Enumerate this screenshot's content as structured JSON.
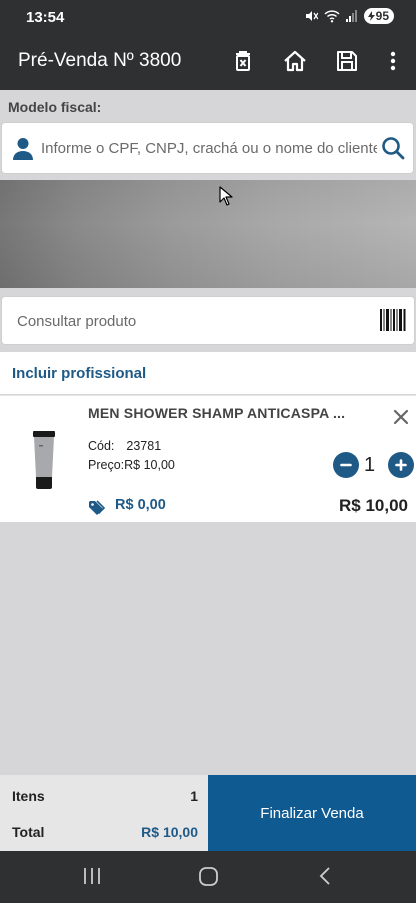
{
  "status": {
    "time": "13:54",
    "battery": "95"
  },
  "appbar": {
    "title": "Pré-Venda Nº 3800"
  },
  "form": {
    "fiscal_label": "Modelo fiscal:",
    "customer_placeholder": "Informe o CPF, CNPJ, crachá ou o nome do cliente",
    "product_placeholder": "Consultar produto",
    "incluir_profissional": "Incluir profissional"
  },
  "item": {
    "name": "MEN SHOWER SHAMP ANTICASPA ...",
    "code_label": "Cód:",
    "code_value": "23781",
    "price_text": "Preço:R$ 10,00",
    "quantity": "1",
    "discount": "R$ 0,00",
    "total": "R$ 10,00"
  },
  "footer": {
    "items_label": "Itens",
    "items_count": "1",
    "total_label": "Total",
    "total_value": "R$ 10,00",
    "finalize_label": "Finalizar Venda"
  },
  "icons": {
    "appbar": [
      "delete-sale-icon",
      "home-icon",
      "save-icon",
      "more-vertical-icon"
    ],
    "accent": "#1f5a87",
    "button": "#0f5a90"
  }
}
